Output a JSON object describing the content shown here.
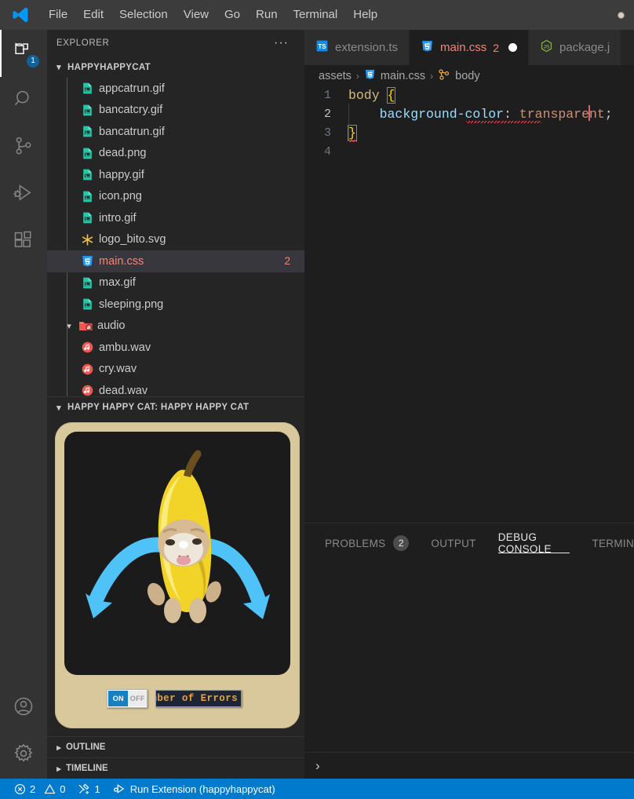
{
  "titlebar": {
    "logo_icon": "vscode-logo-icon",
    "menu": [
      "File",
      "Edit",
      "Selection",
      "View",
      "Go",
      "Run",
      "Terminal",
      "Help"
    ]
  },
  "activitybar": {
    "items": [
      {
        "name": "explorer",
        "icon": "files-icon",
        "badge": "1",
        "active": true
      },
      {
        "name": "search",
        "icon": "search-icon",
        "badge": "",
        "active": false
      },
      {
        "name": "source-control",
        "icon": "source-control-icon",
        "badge": "",
        "active": false
      },
      {
        "name": "run-and-debug",
        "icon": "run-debug-icon",
        "badge": "",
        "active": false
      },
      {
        "name": "extensions",
        "icon": "extensions-icon",
        "badge": "",
        "active": false
      }
    ],
    "bottom": [
      {
        "name": "accounts",
        "icon": "account-icon"
      },
      {
        "name": "manage",
        "icon": "gear-icon"
      }
    ]
  },
  "sidebar": {
    "title": "EXPLORER",
    "more_actions": "···",
    "project": {
      "name": "HAPPYHAPPYCAT",
      "expanded": true
    },
    "files": [
      {
        "name": "appcatrun.gif",
        "icon": "image-file-icon",
        "depth": 1,
        "selected": false,
        "badge": ""
      },
      {
        "name": "bancatcry.gif",
        "icon": "image-file-icon",
        "depth": 1,
        "selected": false,
        "badge": ""
      },
      {
        "name": "bancatrun.gif",
        "icon": "image-file-icon",
        "depth": 1,
        "selected": false,
        "badge": ""
      },
      {
        "name": "dead.png",
        "icon": "image-file-icon",
        "depth": 1,
        "selected": false,
        "badge": ""
      },
      {
        "name": "happy.gif",
        "icon": "image-file-icon",
        "depth": 1,
        "selected": false,
        "badge": ""
      },
      {
        "name": "icon.png",
        "icon": "image-file-icon",
        "depth": 1,
        "selected": false,
        "badge": ""
      },
      {
        "name": "intro.gif",
        "icon": "image-file-icon",
        "depth": 1,
        "selected": false,
        "badge": ""
      },
      {
        "name": "logo_bito.svg",
        "icon": "svg-file-icon",
        "depth": 1,
        "selected": false,
        "badge": ""
      },
      {
        "name": "main.css",
        "icon": "css-file-icon",
        "depth": 1,
        "selected": true,
        "badge": "2"
      },
      {
        "name": "max.gif",
        "icon": "image-file-icon",
        "depth": 1,
        "selected": false,
        "badge": ""
      },
      {
        "name": "sleeping.png",
        "icon": "image-file-icon",
        "depth": 1,
        "selected": false,
        "badge": ""
      },
      {
        "name": "audio",
        "icon": "audio-folder-icon",
        "depth": 0,
        "selected": false,
        "badge": "",
        "folder": true,
        "expanded": true
      },
      {
        "name": "ambu.wav",
        "icon": "audio-file-icon",
        "depth": 1,
        "selected": false,
        "badge": ""
      },
      {
        "name": "cry.wav",
        "icon": "audio-file-icon",
        "depth": 1,
        "selected": false,
        "badge": ""
      },
      {
        "name": "dead.wav",
        "icon": "audio-file-icon",
        "depth": 1,
        "selected": false,
        "badge": ""
      }
    ],
    "webview": {
      "title": "HAPPY HAPPY CAT: HAPPY HAPPY CAT",
      "expanded": true,
      "toggle": {
        "on_label": "ON",
        "off_label": "OFF",
        "state": "ON"
      },
      "error_counter_label": "mber of Errors",
      "screen_content": "crying-banana-cat"
    },
    "bottom_sections": [
      {
        "label": "OUTLINE",
        "expanded": false
      },
      {
        "label": "TIMELINE",
        "expanded": false
      }
    ]
  },
  "editor": {
    "tabs": [
      {
        "label": "extension.ts",
        "icon": "typescript-file-icon",
        "badge": "",
        "dirty": false,
        "active": false
      },
      {
        "label": "main.css",
        "icon": "css-file-icon",
        "badge": "2",
        "dirty": true,
        "active": true
      },
      {
        "label": "package.j",
        "icon": "json-file-icon",
        "badge": "",
        "dirty": false,
        "active": false
      }
    ],
    "breadcrumb": [
      "assets",
      "main.css",
      "body"
    ],
    "breadcrumb_icons": [
      "",
      "css-file-icon",
      "css-selector-icon"
    ],
    "separator": "›",
    "lines": [
      {
        "no": "1",
        "tokens": [
          {
            "t": "body",
            "c": "tok-sel"
          },
          {
            "t": " ",
            "c": "tok-punc"
          },
          {
            "t": "{",
            "c": "tok-brace bracket-box"
          }
        ]
      },
      {
        "no": "2",
        "tokens": [
          {
            "t": "    ",
            "c": "tok-punc"
          },
          {
            "t": "background-color",
            "c": "tok-prop"
          },
          {
            "t": ":",
            "c": "tok-punc"
          },
          {
            "t": " ",
            "c": "tok-punc"
          },
          {
            "t": "transpare",
            "c": "tok-val"
          },
          {
            "t": "CURSOR",
            "c": "cursor"
          },
          {
            "t": "nt",
            "c": "tok-val"
          },
          {
            "t": ";",
            "c": "tok-punc"
          }
        ]
      },
      {
        "no": "3",
        "tokens": [
          {
            "t": "}",
            "c": "tok-brace bracket-box"
          }
        ]
      },
      {
        "no": "4",
        "tokens": []
      }
    ],
    "current_line": "2"
  },
  "panel": {
    "tabs": [
      {
        "label": "PROBLEMS",
        "badge": "2",
        "active": false
      },
      {
        "label": "OUTPUT",
        "badge": "",
        "active": false
      },
      {
        "label": "DEBUG CONSOLE",
        "badge": "",
        "active": true
      },
      {
        "label": "TERMIN",
        "badge": "",
        "active": false
      }
    ],
    "console_prompt": "›"
  },
  "statusbar": {
    "errors": "2",
    "warnings": "0",
    "ports": "1",
    "run_label": "Run Extension (happyhappycat)",
    "accent": "#007acc"
  },
  "colors": {
    "editor_bg": "#1e1e1e",
    "sidebar_bg": "#252526",
    "activitybar_bg": "#333333",
    "titlebar_bg": "#3c3c3c",
    "error_red": "#f48771",
    "accent_blue": "#007acc",
    "card_tan": "#d9c89b"
  }
}
